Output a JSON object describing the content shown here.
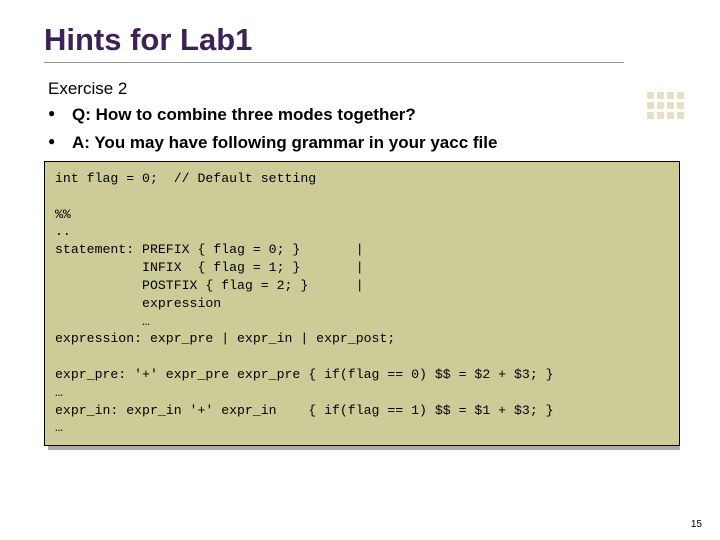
{
  "title": "Hints for Lab1",
  "exercise": "Exercise 2",
  "bullets": {
    "q": "Q: How to combine three modes together?",
    "a": "A: You may have following grammar in your yacc file"
  },
  "code": "int flag = 0;  // Default setting\n\n%%\n..\nstatement: PREFIX { flag = 0; }       |\n           INFIX  { flag = 1; }       |\n           POSTFIX { flag = 2; }      |\n           expression\n           …\nexpression: expr_pre | expr_in | expr_post;\n\nexpr_pre: '+' expr_pre expr_pre { if(flag == 0) $$ = $2 + $3; }\n…\nexpr_in: expr_in '+' expr_in    { if(flag == 1) $$ = $1 + $3; }\n…",
  "page": "15"
}
